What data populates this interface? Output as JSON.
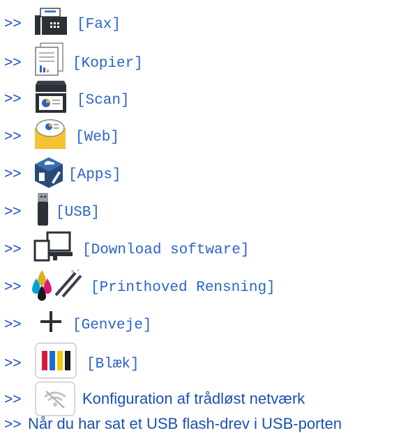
{
  "colors": {
    "link": "#1a50b4",
    "label": "#2a64c8"
  },
  "items": [
    {
      "arrow": ">>",
      "label": "[Fax]",
      "icon": "fax-icon"
    },
    {
      "arrow": ">>",
      "label": "[Kopier]",
      "icon": "copy-document-icon"
    },
    {
      "arrow": ">>",
      "label": "[Scan]",
      "icon": "scanner-icon"
    },
    {
      "arrow": ">>",
      "label": "[Web]",
      "icon": "web-folder-icon"
    },
    {
      "arrow": ">>",
      "label": "[Apps]",
      "icon": "apps-cube-icon"
    },
    {
      "arrow": ">>",
      "label": "[USB]",
      "icon": "usb-drive-icon"
    },
    {
      "arrow": ">>",
      "label": "[Download software]",
      "icon": "devices-download-icon"
    },
    {
      "arrow": ">>",
      "label": "[Printhoved Rensning]",
      "icon": "printhead-cleaning-icon"
    },
    {
      "arrow": ">>",
      "label": "[Genveje]",
      "icon": "plus-shortcut-icon"
    },
    {
      "arrow": ">>",
      "label": "[Blæk]",
      "icon": "ink-cartridges-icon"
    },
    {
      "arrow": ">>",
      "label": "Konfiguration af trådløst netværk",
      "icon": "wifi-off-icon"
    },
    {
      "arrow": ">>",
      "label": "Når du har sat et USB flash-drev i USB-porten"
    }
  ]
}
